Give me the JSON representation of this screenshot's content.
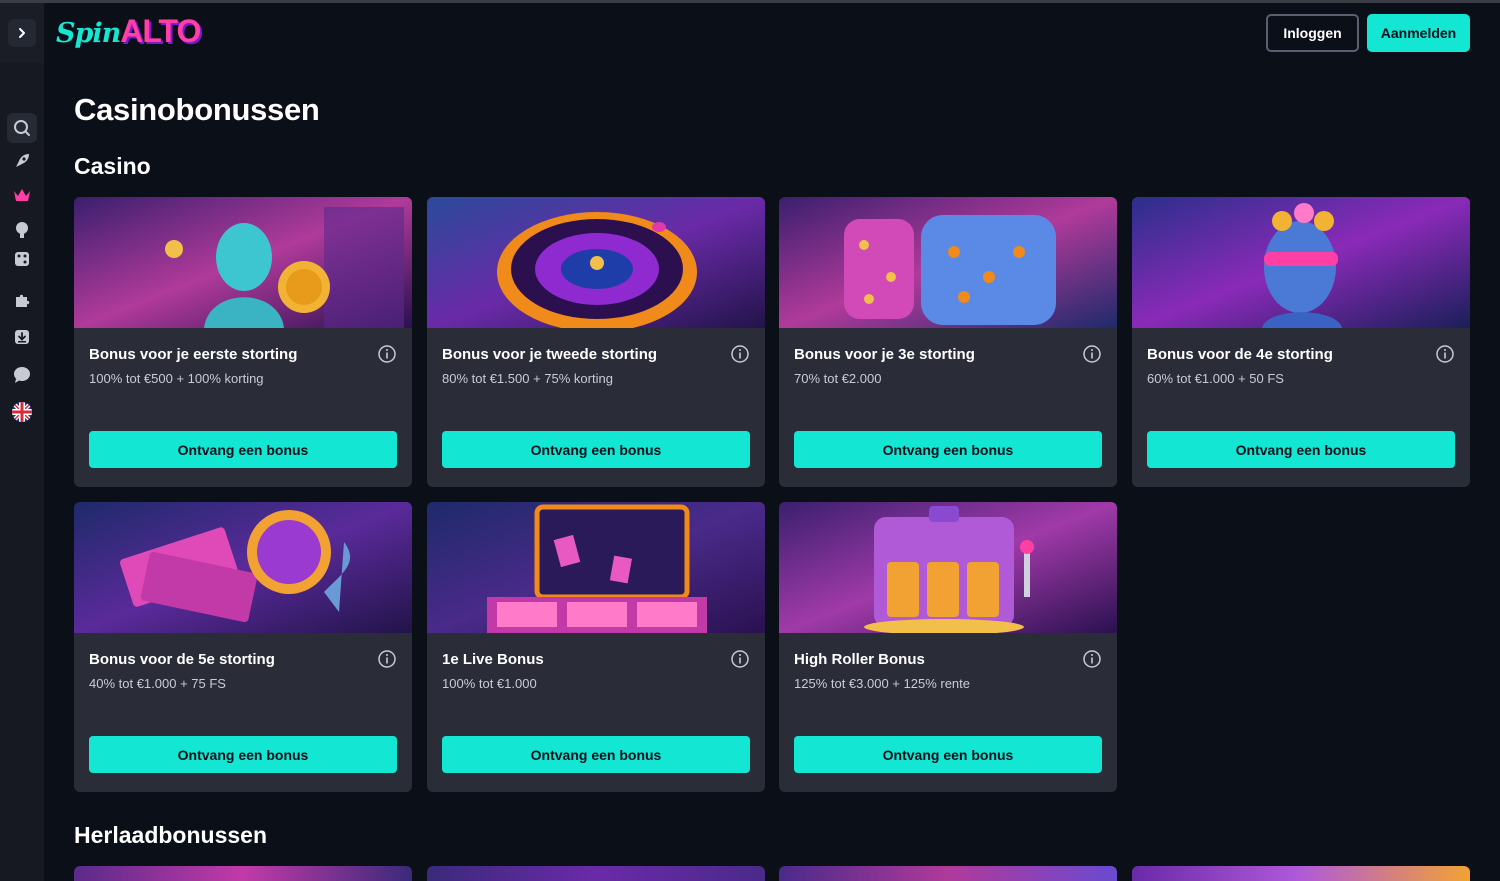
{
  "header": {
    "logo_spin": "Spin",
    "logo_alto": "ALTO",
    "login_label": "Inloggen",
    "register_label": "Aanmelden"
  },
  "sidebar": {
    "items": [
      {
        "icon": "search-icon"
      },
      {
        "icon": "rocket-icon"
      },
      {
        "icon": "crown-icon"
      },
      {
        "icon": "live-icon"
      },
      {
        "icon": "dice-icon"
      },
      {
        "icon": "puzzle-icon"
      },
      {
        "icon": "download-icon"
      },
      {
        "icon": "chat-icon"
      },
      {
        "icon": "uk-flag-icon"
      }
    ]
  },
  "main": {
    "page_title": "Casinobonussen",
    "section_casino": "Casino",
    "section_reload": "Herlaadbonussen",
    "cards": [
      {
        "title": "Bonus voor je eerste storting",
        "subtitle": "100% tot €500 + 100% korting",
        "button": "Ontvang een bonus"
      },
      {
        "title": "Bonus voor je tweede storting",
        "subtitle": "80% tot €1.500 + 75% korting",
        "button": "Ontvang een bonus"
      },
      {
        "title": "Bonus voor je 3e storting",
        "subtitle": "70% tot €2.000",
        "button": "Ontvang een bonus"
      },
      {
        "title": "Bonus voor de 4e storting",
        "subtitle": "60% tot €1.000 + 50 FS",
        "button": "Ontvang een bonus"
      },
      {
        "title": "Bonus voor de 5e storting",
        "subtitle": "40% tot €1.000 + 75 FS",
        "button": "Ontvang een bonus"
      },
      {
        "title": "1e Live Bonus",
        "subtitle": "100% tot €1.000",
        "button": "Ontvang een bonus"
      },
      {
        "title": "High Roller Bonus",
        "subtitle": "125% tot €3.000 + 125% rente",
        "button": "Ontvang een bonus"
      }
    ]
  },
  "colors": {
    "accent": "#14e6d4",
    "background": "#0b0f18",
    "card": "#2a2d38",
    "logo_pink": "#ff3fa4"
  }
}
